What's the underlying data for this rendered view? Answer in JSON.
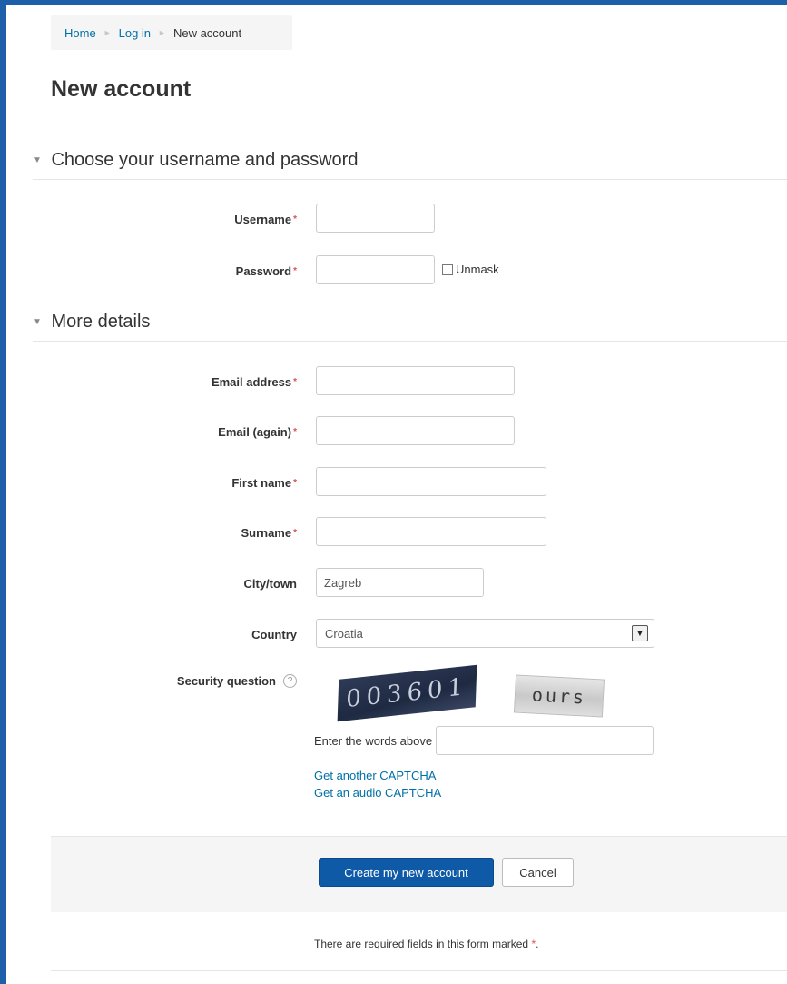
{
  "breadcrumb": {
    "home": "Home",
    "login": "Log in",
    "current": "New account",
    "separator": "►"
  },
  "page": {
    "title": "New account"
  },
  "section_credentials": {
    "arrow": "▼",
    "title": "Choose your username and password",
    "username_label": "Username",
    "username_value": "",
    "password_label": "Password",
    "password_value": "",
    "unmask_label": "Unmask",
    "required_star": "*"
  },
  "section_details": {
    "arrow": "▼",
    "title": "More details",
    "email_label": "Email address",
    "email_value": "",
    "email_again_label": "Email (again)",
    "email_again_value": "",
    "first_name_label": "First name",
    "first_name_value": "",
    "surname_label": "Surname",
    "surname_value": "",
    "city_label": "City/town",
    "city_value": "Zagreb",
    "country_label": "Country",
    "country_value": "Croatia",
    "dropdown_glyph": "▼",
    "required_star": "*"
  },
  "captcha": {
    "label": "Security question",
    "help_glyph": "?",
    "word1": "003601",
    "word2": "ours",
    "enter_label": "Enter the words above",
    "enter_value": "",
    "get_another": "Get another CAPTCHA",
    "get_audio": "Get an audio CAPTCHA"
  },
  "actions": {
    "submit": "Create my new account",
    "cancel": "Cancel"
  },
  "footer": {
    "required_note": "There are required fields in this form marked",
    "star": "*",
    "period": "."
  },
  "colors": {
    "link": "#0070a8",
    "primary_button": "#0f5aa7",
    "required": "#d9534f",
    "frame": "#1d5fa8"
  }
}
